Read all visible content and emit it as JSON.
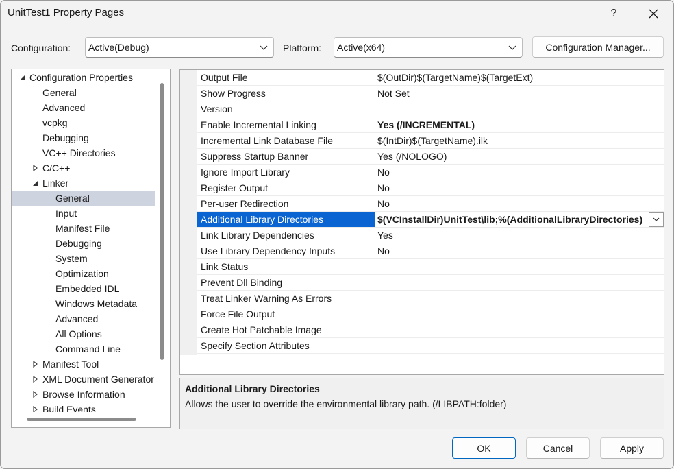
{
  "window": {
    "title": "UnitTest1 Property Pages",
    "help_label": "?",
    "close_label": "✕"
  },
  "toolbar": {
    "configuration_label": "Configuration:",
    "configuration_value": "Active(Debug)",
    "platform_label": "Platform:",
    "platform_value": "Active(x64)",
    "config_manager_label": "Configuration Manager..."
  },
  "tree": {
    "items": [
      {
        "label": "Configuration Properties",
        "expander": "expanded"
      },
      {
        "label": "General"
      },
      {
        "label": "Advanced"
      },
      {
        "label": "vcpkg"
      },
      {
        "label": "Debugging"
      },
      {
        "label": "VC++ Directories"
      },
      {
        "label": "C/C++",
        "expander": "collapsed"
      },
      {
        "label": "Linker",
        "expander": "expanded"
      },
      {
        "label": "General",
        "selected": true
      },
      {
        "label": "Input"
      },
      {
        "label": "Manifest File"
      },
      {
        "label": "Debugging"
      },
      {
        "label": "System"
      },
      {
        "label": "Optimization"
      },
      {
        "label": "Embedded IDL"
      },
      {
        "label": "Windows Metadata"
      },
      {
        "label": "Advanced"
      },
      {
        "label": "All Options"
      },
      {
        "label": "Command Line"
      },
      {
        "label": "Manifest Tool",
        "expander": "collapsed"
      },
      {
        "label": "XML Document Generator",
        "expander": "collapsed"
      },
      {
        "label": "Browse Information",
        "expander": "collapsed"
      },
      {
        "label": "Build Events",
        "expander": "collapsed"
      }
    ]
  },
  "grid": {
    "rows": [
      {
        "name": "Output File",
        "value": "$(OutDir)$(TargetName)$(TargetExt)"
      },
      {
        "name": "Show Progress",
        "value": "Not Set"
      },
      {
        "name": "Version",
        "value": ""
      },
      {
        "name": "Enable Incremental Linking",
        "value": "Yes (/INCREMENTAL)",
        "bold": true
      },
      {
        "name": "Incremental Link Database File",
        "value": "$(IntDir)$(TargetName).ilk"
      },
      {
        "name": "Suppress Startup Banner",
        "value": "Yes (/NOLOGO)"
      },
      {
        "name": "Ignore Import Library",
        "value": "No"
      },
      {
        "name": "Register Output",
        "value": "No"
      },
      {
        "name": "Per-user Redirection",
        "value": "No"
      },
      {
        "name": "Additional Library Directories",
        "value": "$(VCInstallDir)UnitTest\\lib;%(AdditionalLibraryDirectories)",
        "bold": true,
        "selected": true
      },
      {
        "name": "Link Library Dependencies",
        "value": "Yes"
      },
      {
        "name": "Use Library Dependency Inputs",
        "value": "No"
      },
      {
        "name": "Link Status",
        "value": ""
      },
      {
        "name": "Prevent Dll Binding",
        "value": ""
      },
      {
        "name": "Treat Linker Warning As Errors",
        "value": ""
      },
      {
        "name": "Force File Output",
        "value": ""
      },
      {
        "name": "Create Hot Patchable Image",
        "value": ""
      },
      {
        "name": "Specify Section Attributes",
        "value": ""
      }
    ]
  },
  "description": {
    "title": "Additional Library Directories",
    "text": "Allows the user to override the environmental library path. (/LIBPATH:folder)"
  },
  "buttons": {
    "ok": "OK",
    "cancel": "Cancel",
    "apply": "Apply"
  },
  "colors": {
    "selection_blue": "#0a64d2",
    "tree_selection": "#cdd3df"
  }
}
